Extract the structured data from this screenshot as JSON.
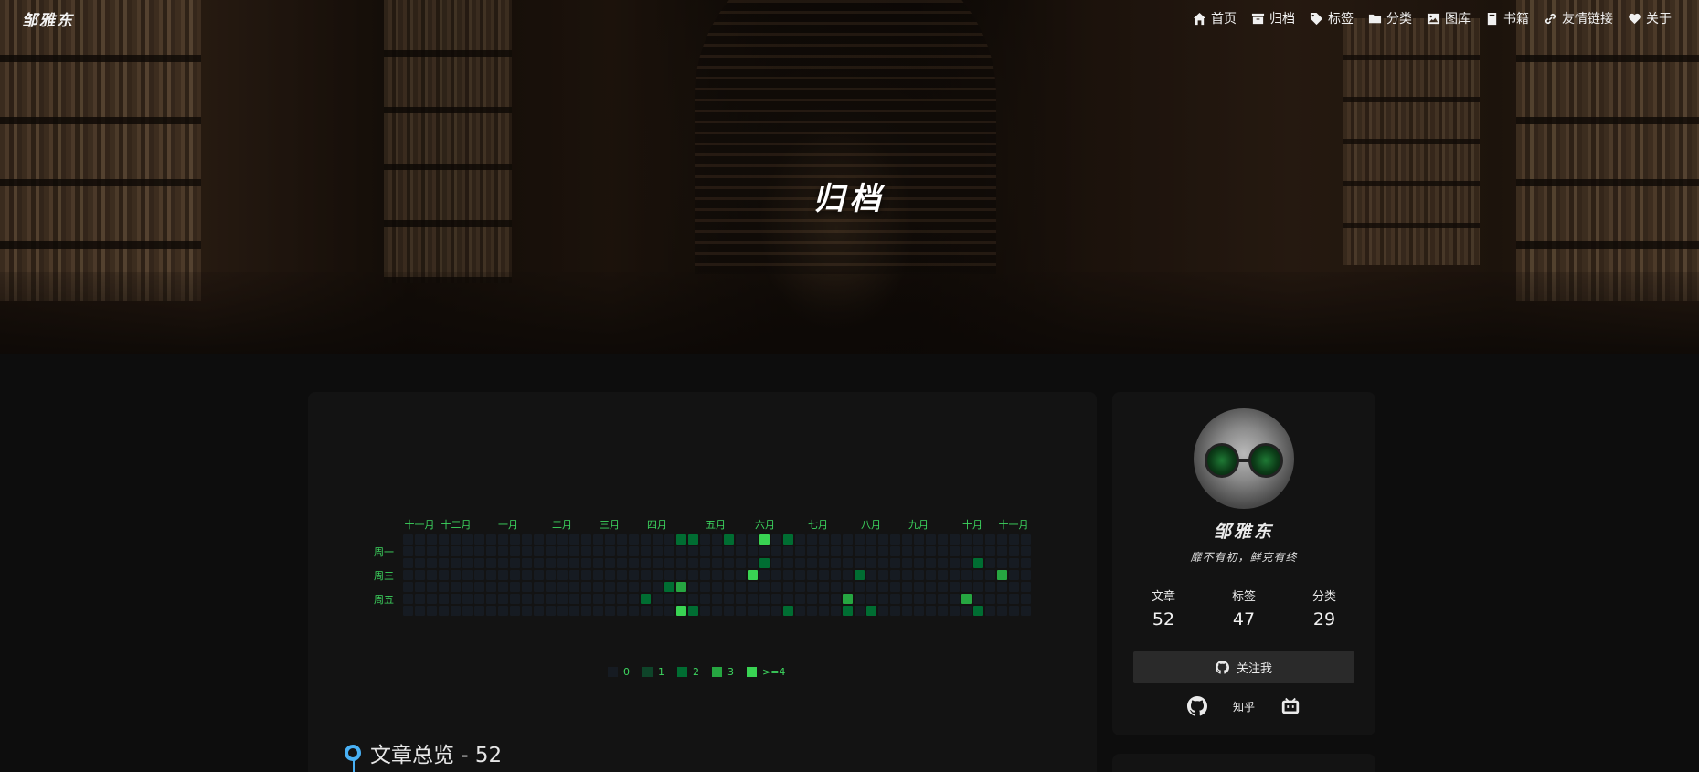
{
  "site": {
    "logo": "邹雅东",
    "page_title": "归档"
  },
  "nav": [
    {
      "label": "首页",
      "icon": "home-icon"
    },
    {
      "label": "归档",
      "icon": "archive-icon"
    },
    {
      "label": "标签",
      "icon": "tag-icon"
    },
    {
      "label": "分类",
      "icon": "folder-icon"
    },
    {
      "label": "图库",
      "icon": "image-icon"
    },
    {
      "label": "书籍",
      "icon": "book-icon"
    },
    {
      "label": "友情链接",
      "icon": "link-icon"
    },
    {
      "label": "关于",
      "icon": "heart-icon"
    }
  ],
  "heatmap": {
    "months": [
      "十一月",
      "十二月",
      "一月",
      "二月",
      "三月",
      "四月",
      "五月",
      "六月",
      "七月",
      "八月",
      "九月",
      "十月",
      "十一月"
    ],
    "weekdays": [
      "周一",
      "周三",
      "周五"
    ],
    "legend": [
      "0",
      "1",
      "2",
      "3",
      ">=4"
    ],
    "colors": [
      "#161b22",
      "#0e4429",
      "#006d32",
      "#26a641",
      "#39d353"
    ],
    "weeks": 53,
    "active": [
      {
        "w": 23,
        "d": 0,
        "l": 2
      },
      {
        "w": 24,
        "d": 0,
        "l": 2
      },
      {
        "w": 27,
        "d": 0,
        "l": 2
      },
      {
        "w": 30,
        "d": 0,
        "l": 4
      },
      {
        "w": 32,
        "d": 0,
        "l": 2
      },
      {
        "w": 30,
        "d": 2,
        "l": 2
      },
      {
        "w": 48,
        "d": 2,
        "l": 2
      },
      {
        "w": 29,
        "d": 3,
        "l": 4
      },
      {
        "w": 38,
        "d": 3,
        "l": 2
      },
      {
        "w": 50,
        "d": 3,
        "l": 3
      },
      {
        "w": 22,
        "d": 4,
        "l": 2
      },
      {
        "w": 23,
        "d": 4,
        "l": 3
      },
      {
        "w": 20,
        "d": 5,
        "l": 2
      },
      {
        "w": 37,
        "d": 5,
        "l": 3
      },
      {
        "w": 47,
        "d": 5,
        "l": 3
      },
      {
        "w": 23,
        "d": 6,
        "l": 4
      },
      {
        "w": 24,
        "d": 6,
        "l": 2
      },
      {
        "w": 32,
        "d": 6,
        "l": 2
      },
      {
        "w": 37,
        "d": 6,
        "l": 2
      },
      {
        "w": 39,
        "d": 6,
        "l": 2
      },
      {
        "w": 48,
        "d": 6,
        "l": 2
      }
    ]
  },
  "overview": {
    "title": "文章总览 - 52"
  },
  "profile": {
    "name": "邹雅东",
    "motto": "靡不有初，鲜克有终",
    "stats": [
      {
        "label": "文章",
        "value": "52"
      },
      {
        "label": "标签",
        "value": "47"
      },
      {
        "label": "分类",
        "value": "29"
      }
    ],
    "follow_label": "关注我",
    "socials": [
      {
        "name": "github",
        "icon": "github-icon"
      },
      {
        "name": "知乎",
        "icon": "zhihu-icon"
      },
      {
        "name": "bilibili",
        "icon": "bilibili-icon"
      }
    ]
  }
}
